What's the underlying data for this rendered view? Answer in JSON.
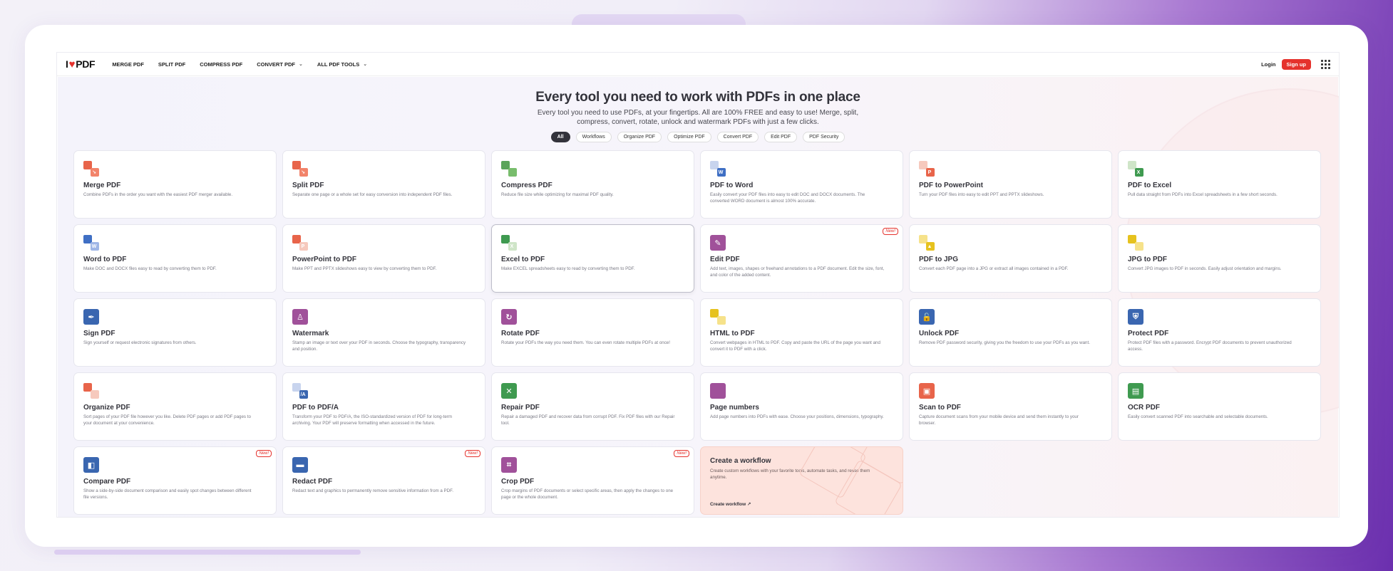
{
  "nav": {
    "logo_left": "I",
    "logo_heart": "♥",
    "logo_right": "PDF",
    "items": [
      {
        "label": "MERGE PDF",
        "chevron": false
      },
      {
        "label": "SPLIT PDF",
        "chevron": false
      },
      {
        "label": "COMPRESS PDF",
        "chevron": false
      },
      {
        "label": "CONVERT PDF",
        "chevron": true
      },
      {
        "label": "ALL PDF TOOLS",
        "chevron": true
      }
    ],
    "login": "Login",
    "signup": "Sign up"
  },
  "hero": {
    "title": "Every tool you need to work with PDFs in one place",
    "subtitle": "Every tool you need to use PDFs, at your fingertips. All are 100% FREE and easy to use! Merge, split, compress, convert, rotate, unlock and watermark PDFs with just a few clicks."
  },
  "filters": [
    "All",
    "Workflows",
    "Organize PDF",
    "Optimize PDF",
    "Convert PDF",
    "Edit PDF",
    "PDF Security"
  ],
  "active_filter": "All",
  "tools": [
    {
      "title": "Merge PDF",
      "desc": "Combine PDFs in the order you want with the easiest PDF merger available.",
      "icon": "merge-icon",
      "color": "#e8644a",
      "color2": "#f2836a",
      "glyph": "↘",
      "badge": ""
    },
    {
      "title": "Split PDF",
      "desc": "Separate one page or a whole set for easy conversion into independent PDF files.",
      "icon": "split-icon",
      "color": "#e8644a",
      "color2": "#f2836a",
      "glyph": "↘",
      "badge": ""
    },
    {
      "title": "Compress PDF",
      "desc": "Reduce file size while optimizing for maximal PDF quality.",
      "icon": "compress-icon",
      "color": "#5aa45a",
      "color2": "#78bd6c",
      "glyph": "",
      "badge": ""
    },
    {
      "title": "PDF to Word",
      "desc": "Easily convert your PDF files into easy to edit DOC and DOCX documents. The converted WORD document is almost 100% accurate.",
      "icon": "pdf-to-word-icon",
      "color": "#c8d4ee",
      "color2": "#3f6fc4",
      "glyph": "W",
      "badge": ""
    },
    {
      "title": "PDF to PowerPoint",
      "desc": "Turn your PDF files into easy to edit PPT and PPTX slideshows.",
      "icon": "pdf-to-powerpoint-icon",
      "color": "#f6c9bd",
      "color2": "#e8644a",
      "glyph": "P",
      "badge": ""
    },
    {
      "title": "PDF to Excel",
      "desc": "Pull data straight from PDFs into Excel spreadsheets in a few short seconds.",
      "icon": "pdf-to-excel-icon",
      "color": "#cfe5c8",
      "color2": "#3f9a50",
      "glyph": "X",
      "badge": ""
    },
    {
      "title": "Word to PDF",
      "desc": "Make DOC and DOCX files easy to read by converting them to PDF.",
      "icon": "word-to-pdf-icon",
      "color": "#3f6fc4",
      "color2": "#9fb6e6",
      "glyph": "W",
      "badge": ""
    },
    {
      "title": "PowerPoint to PDF",
      "desc": "Make PPT and PPTX slideshows easy to view by converting them to PDF.",
      "icon": "powerpoint-to-pdf-icon",
      "color": "#e8644a",
      "color2": "#f6c9bd",
      "glyph": "P",
      "badge": ""
    },
    {
      "title": "Excel to PDF",
      "desc": "Make EXCEL spreadsheets easy to read by converting them to PDF.",
      "icon": "excel-to-pdf-icon",
      "color": "#3f9a50",
      "color2": "#cfe5c8",
      "glyph": "X",
      "badge": ""
    },
    {
      "title": "Edit PDF",
      "desc": "Add text, images, shapes or freehand annotations to a PDF document. Edit the size, font, and color of the added content.",
      "icon": "edit-pdf-icon",
      "color": "#a0519a",
      "color2": "#a0519a",
      "glyph": "✎",
      "badge": "New!"
    },
    {
      "title": "PDF to JPG",
      "desc": "Convert each PDF page into a JPG or extract all images contained in a PDF.",
      "icon": "pdf-to-jpg-icon",
      "color": "#f6e28a",
      "color2": "#e6c21e",
      "glyph": "▲",
      "badge": ""
    },
    {
      "title": "JPG to PDF",
      "desc": "Convert JPG images to PDF in seconds. Easily adjust orientation and margins.",
      "icon": "jpg-to-pdf-icon",
      "color": "#e6c21e",
      "color2": "#f6e28a",
      "glyph": "",
      "badge": ""
    },
    {
      "title": "Sign PDF",
      "desc": "Sign yourself or request electronic signatures from others.",
      "icon": "sign-pdf-icon",
      "color": "#3a66b0",
      "color2": "#3a66b0",
      "glyph": "✒",
      "badge": ""
    },
    {
      "title": "Watermark",
      "desc": "Stamp an image or text over your PDF in seconds. Choose the typography, transparency and position.",
      "icon": "watermark-icon",
      "color": "#a0519a",
      "color2": "#a0519a",
      "glyph": "♙",
      "badge": ""
    },
    {
      "title": "Rotate PDF",
      "desc": "Rotate your PDFs the way you need them. You can even rotate multiple PDFs at once!",
      "icon": "rotate-pdf-icon",
      "color": "#a0519a",
      "color2": "#a0519a",
      "glyph": "↻",
      "badge": ""
    },
    {
      "title": "HTML to PDF",
      "desc": "Convert webpages in HTML to PDF. Copy and paste the URL of the page you want and convert it to PDF with a click.",
      "icon": "html-to-pdf-icon",
      "color": "#e6c21e",
      "color2": "#f6e28a",
      "glyph": "",
      "badge": ""
    },
    {
      "title": "Unlock PDF",
      "desc": "Remove PDF password security, giving you the freedom to use your PDFs as you want.",
      "icon": "unlock-pdf-icon",
      "color": "#3a66b0",
      "color2": "#3a66b0",
      "glyph": "🔓",
      "badge": ""
    },
    {
      "title": "Protect PDF",
      "desc": "Protect PDF files with a password. Encrypt PDF documents to prevent unauthorized access.",
      "icon": "protect-pdf-icon",
      "color": "#3a66b0",
      "color2": "#3a66b0",
      "glyph": "⛨",
      "badge": ""
    },
    {
      "title": "Organize PDF",
      "desc": "Sort pages of your PDF file however you like. Delete PDF pages or add PDF pages to your document at your convenience.",
      "icon": "organize-pdf-icon",
      "color": "#e8644a",
      "color2": "#f6c9bd",
      "glyph": "",
      "badge": ""
    },
    {
      "title": "PDF to PDF/A",
      "desc": "Transform your PDF to PDF/A, the ISO-standardized version of PDF for long-term archiving. Your PDF will preserve formatting when accessed in the future.",
      "icon": "pdf-to-pdfa-icon",
      "color": "#c8d4ee",
      "color2": "#3a66b0",
      "glyph": "/A",
      "badge": ""
    },
    {
      "title": "Repair PDF",
      "desc": "Repair a damaged PDF and recover data from corrupt PDF. Fix PDF files with our Repair tool.",
      "icon": "repair-pdf-icon",
      "color": "#3f9a50",
      "color2": "#3f9a50",
      "glyph": "✕",
      "badge": ""
    },
    {
      "title": "Page numbers",
      "desc": "Add page numbers into PDFs with ease. Choose your positions, dimensions, typography.",
      "icon": "page-numbers-icon",
      "color": "#a0519a",
      "color2": "#a0519a",
      "glyph": "",
      "badge": ""
    },
    {
      "title": "Scan to PDF",
      "desc": "Capture document scans from your mobile device and send them instantly to your browser.",
      "icon": "scan-to-pdf-icon",
      "color": "#e8644a",
      "color2": "#e8644a",
      "glyph": "▣",
      "badge": ""
    },
    {
      "title": "OCR PDF",
      "desc": "Easily convert scanned PDF into searchable and selectable documents.",
      "icon": "ocr-pdf-icon",
      "color": "#3f9a50",
      "color2": "#3f9a50",
      "glyph": "▤",
      "badge": ""
    },
    {
      "title": "Compare PDF",
      "desc": "Show a side-by-side document comparison and easily spot changes between different file versions.",
      "icon": "compare-pdf-icon",
      "color": "#3a66b0",
      "color2": "#3a66b0",
      "glyph": "◧",
      "badge": "New!"
    },
    {
      "title": "Redact PDF",
      "desc": "Redact text and graphics to permanently remove sensitive information from a PDF.",
      "icon": "redact-pdf-icon",
      "color": "#3a66b0",
      "color2": "#3a66b0",
      "glyph": "▬",
      "badge": "New!"
    },
    {
      "title": "Crop PDF",
      "desc": "Crop margins of PDF documents or select specific areas, then apply the changes to one page or the whole document.",
      "icon": "crop-pdf-icon",
      "color": "#a0519a",
      "color2": "#a0519a",
      "glyph": "⌗",
      "badge": "New!"
    }
  ],
  "workflow": {
    "title": "Create a workflow",
    "desc": "Create custom workflows with your favorite tools, automate tasks, and reuse them anytime.",
    "link": "Create workflow ↗"
  }
}
